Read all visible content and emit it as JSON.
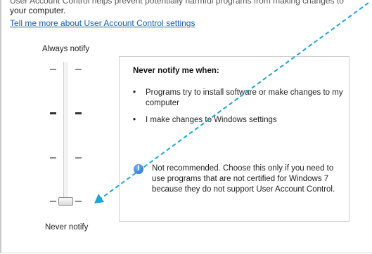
{
  "header": {
    "intro_cut": "User Account Control helps prevent potentially harmful programs from making changes to",
    "intro_line2": "your computer.",
    "learn_more_link": "Tell me more about User Account Control settings"
  },
  "slider": {
    "top_label": "Always notify",
    "bottom_label": "Never notify",
    "level": "Never notify"
  },
  "panel": {
    "title": "Never notify me when:",
    "bullets": [
      "Programs try to install software or make changes to my computer",
      "I make changes to Windows settings"
    ],
    "info_text": "Not recommended. Choose this only if you need to use programs that are not certified for Windows 7 because they do not support User Account Control."
  },
  "annotation": {
    "color": "#1fa3d8",
    "arrow_icon": "arrow-icon"
  }
}
